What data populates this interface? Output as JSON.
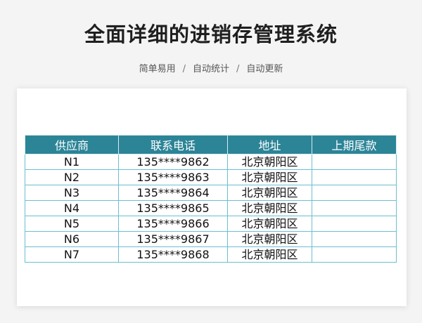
{
  "page": {
    "title": "全面详细的进销存管理系统",
    "subtitle": [
      "简单易用",
      "自动统计",
      "自动更新"
    ],
    "separator": "/"
  },
  "table": {
    "headers": [
      "供应商",
      "联系电话",
      "地址",
      "上期尾款"
    ],
    "rows": [
      [
        "N1",
        "135****9862",
        "北京朝阳区",
        ""
      ],
      [
        "N2",
        "135****9863",
        "北京朝阳区",
        ""
      ],
      [
        "N3",
        "135****9864",
        "北京朝阳区",
        ""
      ],
      [
        "N4",
        "135****9865",
        "北京朝阳区",
        ""
      ],
      [
        "N5",
        "135****9866",
        "北京朝阳区",
        ""
      ],
      [
        "N6",
        "135****9867",
        "北京朝阳区",
        ""
      ],
      [
        "N7",
        "135****9868",
        "北京朝阳区",
        ""
      ]
    ]
  },
  "colors": {
    "header_bg": "#2c8497",
    "border": "#6bbfd0",
    "title": "#1f1f1f"
  }
}
